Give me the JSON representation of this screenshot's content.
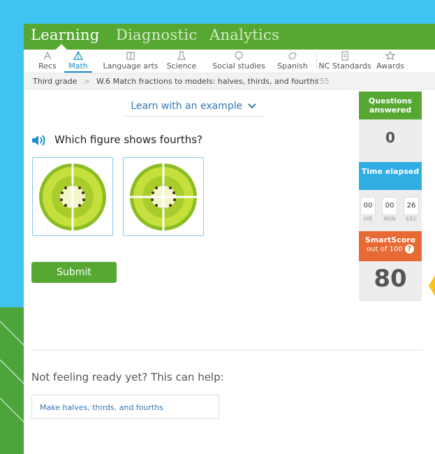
{
  "topnav": {
    "tabs": [
      {
        "label": "Learning"
      },
      {
        "label": "Diagnostic"
      },
      {
        "label": "Analytics"
      }
    ]
  },
  "subnav": {
    "items": [
      {
        "label": "Recs",
        "icon": "recs-icon"
      },
      {
        "label": "Math",
        "icon": "math-icon",
        "active": true
      },
      {
        "label": "Language arts",
        "icon": "language-arts-icon"
      },
      {
        "label": "Science",
        "icon": "science-icon"
      },
      {
        "label": "Social studies",
        "icon": "social-studies-icon"
      },
      {
        "label": "Spanish",
        "icon": "spanish-icon"
      },
      {
        "label": "NC Standards",
        "icon": "standards-icon"
      },
      {
        "label": "Awards",
        "icon": "awards-icon"
      }
    ]
  },
  "breadcrumb": {
    "grade": "Third grade",
    "separator": ">",
    "skill": "W.6 Match fractions to models: halves, thirds, and fourths",
    "code": "Y55"
  },
  "learn_link": "Learn with an example",
  "question": {
    "text": "Which figure shows fourths?"
  },
  "choices": [
    {
      "icon": "kiwi-halves-icon"
    },
    {
      "icon": "kiwi-fourths-icon"
    }
  ],
  "submit_label": "Submit",
  "sidebar": {
    "questions_label": "Questions answered",
    "questions_value": "0",
    "time_label": "Time elapsed",
    "time": {
      "hr": "00",
      "min": "00",
      "sec": "26"
    },
    "time_units": {
      "hr": "HR",
      "min": "MIN",
      "sec": "SEC"
    },
    "smartscore_label": "SmartScore",
    "smartscore_sub": "out of 100",
    "smartscore_value": "80"
  },
  "help": {
    "prompt": "Not feeling ready yet? This can help:",
    "link": "Make halves, thirds, and fourths"
  },
  "colors": {
    "brand_green": "#56a832",
    "accent_blue": "#1a8fce",
    "smartscore_orange": "#e76a35",
    "time_blue": "#30aee3",
    "background_blue": "#3fc4f1",
    "arrow_yellow": "#f7c21a"
  }
}
